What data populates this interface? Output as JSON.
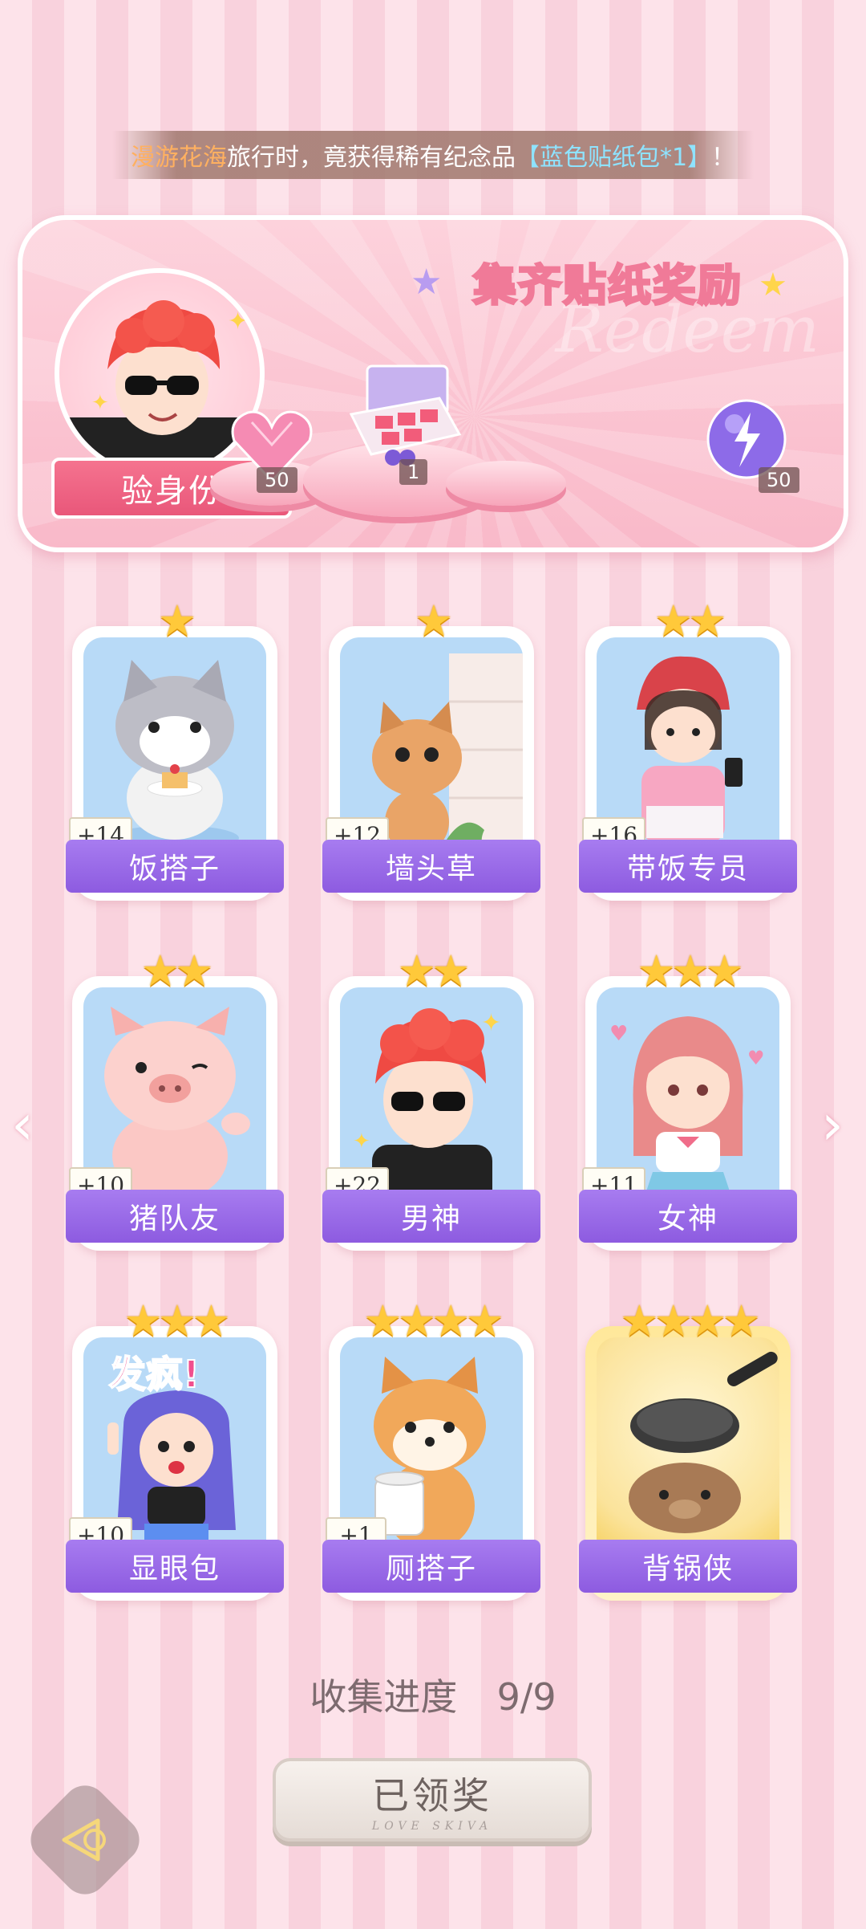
{
  "notice": {
    "part1": "漫游花海",
    "part2": "旅行时，竟获得稀有纪念品",
    "part3": "【蓝色贴纸包*1】",
    "part4": "！"
  },
  "panel": {
    "title": "集齐贴纸奖励",
    "watermark": "Redeem",
    "verify_label": "验身份",
    "rewards": [
      {
        "icon": "pink-heart-gem-icon",
        "count": "50"
      },
      {
        "icon": "sticker-gift-box-icon",
        "count": "1"
      },
      {
        "icon": "purple-energy-orb-icon",
        "count": "50"
      }
    ]
  },
  "stickers": [
    {
      "name": "饭搭子",
      "count": "+14",
      "stars": "★",
      "icon": "cat-with-cake-icon"
    },
    {
      "name": "墙头草",
      "count": "+12",
      "stars": "★",
      "icon": "squirrel-behind-wall-icon"
    },
    {
      "name": "带饭专员",
      "count": "+16",
      "stars": "★★",
      "icon": "girl-with-phone-icon"
    },
    {
      "name": "猪队友",
      "count": "+10",
      "stars": "★★",
      "icon": "pig-waving-icon"
    },
    {
      "name": "男神",
      "count": "+22",
      "stars": "★★",
      "icon": "boy-sunglasses-icon"
    },
    {
      "name": "女神",
      "count": "+11",
      "stars": "★★★",
      "icon": "girl-sailor-uniform-icon"
    },
    {
      "name": "显眼包",
      "count": "+10",
      "stars": "★★★",
      "icon": "crazy-girl-icon",
      "sticker_text": "发疯!"
    },
    {
      "name": "厕搭子",
      "count": "+1",
      "stars": "★★★★",
      "icon": "shiba-toilet-paper-icon"
    },
    {
      "name": "背锅侠",
      "count": "",
      "stars": "★★★★",
      "icon": "capybara-with-pan-icon"
    }
  ],
  "progress": {
    "label": "收集进度",
    "value": "9/9"
  },
  "claim_button": {
    "label": "已领奖",
    "sub": "LOVE SKIVA"
  },
  "nav": {
    "prev": "‹",
    "next": "›"
  },
  "colors": {
    "accent_purple": "#8d5be0",
    "pink": "#f5738f",
    "star_gold": "#ffc93a"
  }
}
